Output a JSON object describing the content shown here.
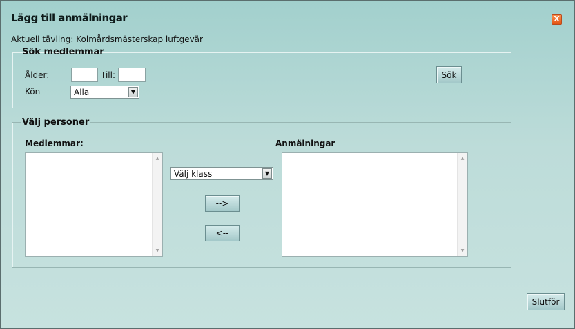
{
  "dialog": {
    "title": "Lägg till anmälningar",
    "close_label": "X",
    "subtitle": "Aktuell tävling: Kolmårdsmästerskap luftgevär"
  },
  "search": {
    "legend": "Sök medlemmar",
    "age_label": "Ålder:",
    "age_from_value": "",
    "to_label": "Till:",
    "age_to_value": "",
    "gender_label": "Kön",
    "gender_selected": "Alla",
    "search_button": "Sök"
  },
  "persons": {
    "legend": "Välj personer",
    "members_label": "Medlemmar:",
    "registrations_label": "Anmälningar",
    "class_selected": "Välj klass",
    "add_button": "-->",
    "remove_button": "<--",
    "members": [],
    "registrations": []
  },
  "footer": {
    "finish_button": "Slutför"
  },
  "icons": {
    "close": "close-icon",
    "dropdown": "chevron-down-icon",
    "scroll_up": "scroll-up-icon",
    "scroll_down": "scroll-down-icon"
  },
  "colors": {
    "dialog_background": "#bddcd9",
    "close_button": "#e35414",
    "button_background": "#a3c8c9"
  }
}
